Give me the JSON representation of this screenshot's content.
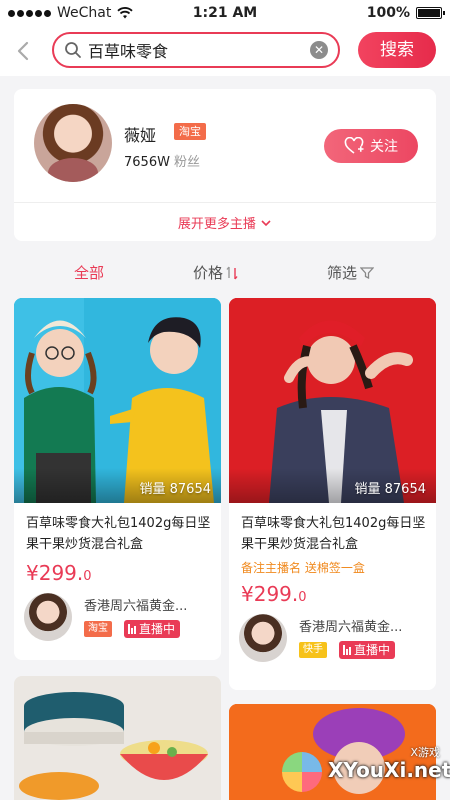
{
  "status_bar": {
    "carrier": "WeChat",
    "time": "1:21 AM",
    "battery": "100%"
  },
  "search": {
    "query": "百草味零食",
    "button_label": "搜索"
  },
  "host": {
    "name": "薇娅",
    "platform_badge": "淘宝",
    "fans_count": "7656W",
    "fans_label": "粉丝",
    "follow_label": "关注",
    "expand_label": "展开更多主播"
  },
  "filters": {
    "all": "全部",
    "price": "价格",
    "screen": "筛选",
    "active": "全部"
  },
  "products": [
    {
      "sales": "销量 87654",
      "title": "百草味零食大礼包1402g每日坚果干果炒货混合礼盒",
      "note": "",
      "price_main": "¥299.",
      "price_decimal": "0",
      "seller_name": "香港周六福黄金...",
      "seller_platform": "淘宝",
      "platform_color": "#f36c4a",
      "live_label": "直播中"
    },
    {
      "sales": "销量 87654",
      "title": "百草味零食大礼包1402g每日坚果干果炒货混合礼盒",
      "note": "备注主播名 送棉签一盒",
      "price_main": "¥299.",
      "price_decimal": "0",
      "seller_name": "香港周六福黄金...",
      "seller_platform": "快手",
      "platform_color": "#f7c21a",
      "live_label": "直播中"
    }
  ],
  "watermark": {
    "text": "XYouXi.net",
    "sub": "X游戏"
  },
  "colors": {
    "accent": "#e93b56",
    "note": "#f08a1f"
  }
}
